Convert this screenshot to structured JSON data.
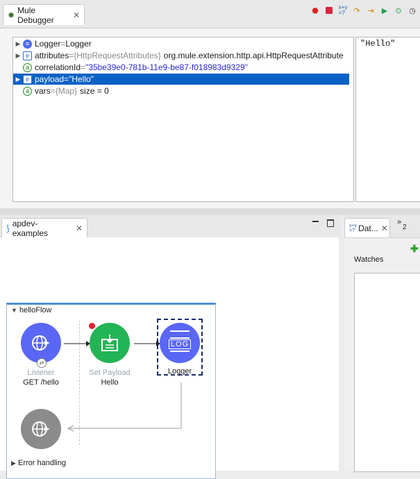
{
  "debugger": {
    "tab_title": "Mule Debugger",
    "toolbar_icons": [
      "breakpoint-icon",
      "stop-icon",
      "evaluate-icon",
      "step-over-icon",
      "step-into-icon",
      "resume-icon",
      "run-to-processor-icon",
      "history-icon"
    ],
    "variables": [
      {
        "name": "Logger",
        "sep": " = ",
        "type": "",
        "value": "Logger",
        "icon": "blue",
        "expandable": true,
        "selected": false
      },
      {
        "name": "attributes",
        "sep": " = ",
        "type": "{HttpRequestAttributes}",
        "value": "org.mule.extension.http.api.HttpRequestAttribute",
        "icon": "e",
        "expandable": true,
        "selected": false
      },
      {
        "name": "correlationId",
        "sep": " = ",
        "type": "",
        "value": "\"35be39e0-781b-11e9-be87-f018983d9329\"",
        "icon": "a",
        "expandable": false,
        "selected": false
      },
      {
        "name": "payload",
        "sep": " = ",
        "type": "",
        "value": "\"Hello\"",
        "icon": "e",
        "expandable": true,
        "selected": true
      },
      {
        "name": "vars",
        "sep": " = ",
        "type": "{Map}",
        "value": "size = 0",
        "icon": "a",
        "expandable": false,
        "selected": false
      }
    ],
    "value_preview": "\"Hello\""
  },
  "editor": {
    "tab_title": "apdev-examples",
    "flow_name": "helloFlow",
    "listener": {
      "title": "Listener",
      "subtitle": "GET /hello"
    },
    "set_payload": {
      "title": "Set Payload",
      "subtitle": "Hello"
    },
    "logger": {
      "title": "Logger",
      "icon_text": "LOG"
    },
    "error_handling": "Error handling"
  },
  "side_panel": {
    "tab_title": "Dat...",
    "overflow_count": "2",
    "watches_label": "Watches"
  },
  "colors": {
    "selection": "#0b62c5",
    "node_blue": "#5a67f5",
    "node_green": "#23b455",
    "node_gray": "#8b8b8b",
    "breakpoint": "#e8202a"
  }
}
